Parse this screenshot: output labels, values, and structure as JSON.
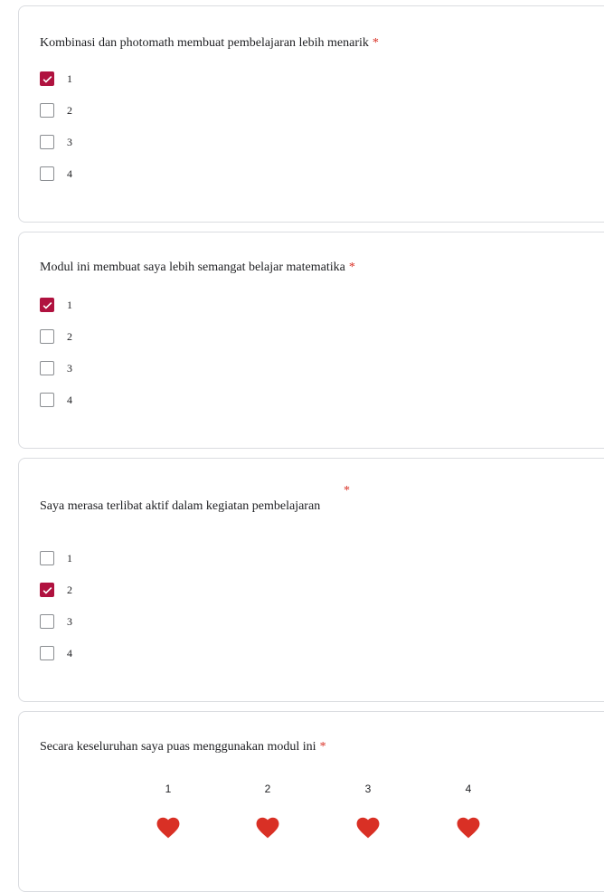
{
  "questions": [
    {
      "title": "Kombinasi dan photomath membuat pembelajaran lebih menarik",
      "required": "*",
      "options": [
        {
          "label": "1",
          "checked": true
        },
        {
          "label": "2",
          "checked": false
        },
        {
          "label": "3",
          "checked": false
        },
        {
          "label": "4",
          "checked": false
        }
      ]
    },
    {
      "title": "Modul ini membuat saya lebih semangat belajar matematika",
      "required": "*",
      "options": [
        {
          "label": "1",
          "checked": true
        },
        {
          "label": "2",
          "checked": false
        },
        {
          "label": "3",
          "checked": false
        },
        {
          "label": "4",
          "checked": false
        }
      ]
    },
    {
      "title": "Saya merasa terlibat aktif dalam kegiatan pembelajaran",
      "required": "*",
      "options": [
        {
          "label": "1",
          "checked": false
        },
        {
          "label": "2",
          "checked": true
        },
        {
          "label": "3",
          "checked": false
        },
        {
          "label": "4",
          "checked": false
        }
      ]
    },
    {
      "title": "Secara keseluruhan saya puas menggunakan modul ini",
      "required": "*",
      "rating": [
        {
          "label": "1",
          "icon": "heart-icon"
        },
        {
          "label": "2",
          "icon": "heart-icon"
        },
        {
          "label": "3",
          "icon": "heart-icon"
        },
        {
          "label": "4",
          "icon": "heart-icon"
        }
      ]
    }
  ],
  "colors": {
    "accent": "#b0123f",
    "required": "#d93025",
    "heart": "#d93025",
    "border": "#dadce0"
  }
}
